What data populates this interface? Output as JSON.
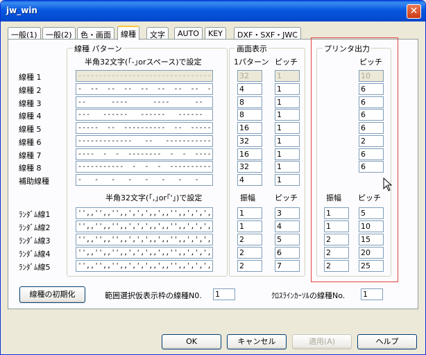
{
  "window": {
    "title": "jw_win",
    "close": "✕"
  },
  "tabs": [
    {
      "label": "一般(1)"
    },
    {
      "label": "一般(2)"
    },
    {
      "label": "色・画面"
    },
    {
      "label": "線種"
    },
    {
      "label": "文字"
    },
    {
      "label": "AUTO"
    },
    {
      "label": "KEY"
    },
    {
      "label": "DXF・SXF・JWC"
    }
  ],
  "pattern_group": {
    "label": "線種 パターン",
    "heading_top": "半角32文字(｢-｣orスペース)で設定",
    "heading_bottom": "半角32文字(｢,｣or｢'｣)で設定"
  },
  "display_group": {
    "label": "画面表示",
    "col1": "1パターン",
    "col2": "ピッチ",
    "col1_random": "振幅",
    "col2_random": "ピッチ"
  },
  "printer_group": {
    "label": "プリンタ出力",
    "col_pitch": "ピッチ",
    "col1_random": "振幅",
    "col2_random": "ピッチ"
  },
  "line_types": [
    {
      "label": "線種 1",
      "pattern": "--------------------------------",
      "pattern_disabled": true,
      "d1": "32",
      "d2": "1",
      "d_disabled": true,
      "p": "10",
      "p_disabled": true
    },
    {
      "label": "線種 2",
      "pattern": "-  --  --  --  --  --  --  --  --",
      "d1": "4",
      "d2": "1",
      "p": "6"
    },
    {
      "label": "線種 3",
      "pattern": "--      ----      ----      --",
      "d1": "8",
      "d2": "1",
      "p": "6"
    },
    {
      "label": "線種 4",
      "pattern": "---   ------   ------   ------   ---",
      "d1": "8",
      "d2": "1",
      "p": "6"
    },
    {
      "label": "線種 5",
      "pattern": "-----  --  ----------  --  -----",
      "d1": "16",
      "d2": "1",
      "p": "6"
    },
    {
      "label": "線種 6",
      "pattern": "-------------   --   ------------",
      "d1": "32",
      "d2": "1",
      "p": "2"
    },
    {
      "label": "線種 7",
      "pattern": "----  -  -  --------  -  -  ----",
      "d1": "16",
      "d2": "1",
      "p": "6"
    },
    {
      "label": "線種 8",
      "pattern": "-----------  -  -  -  -----------",
      "d1": "32",
      "d2": "1",
      "p": "6"
    },
    {
      "label": "補助線種",
      "pattern": "-   -   -   -   -   -   -   -   ",
      "d1": "4",
      "d2": "1"
    }
  ],
  "random_types": [
    {
      "label": "ﾗﾝﾀﾞﾑ線1",
      "pattern": "'',,'',,'',,',',',,',,'',,',',',",
      "d1": "1",
      "d2": "3",
      "p1": "1",
      "p2": "5"
    },
    {
      "label": "ﾗﾝﾀﾞﾑ線2",
      "pattern": "'',,'',,'',,',',',,',,'',,',',',",
      "d1": "1",
      "d2": "4",
      "p1": "1",
      "p2": "10"
    },
    {
      "label": "ﾗﾝﾀﾞﾑ線3",
      "pattern": "'',,'',,'',,',',',,',,'',,',',',",
      "d1": "2",
      "d2": "5",
      "p1": "2",
      "p2": "15"
    },
    {
      "label": "ﾗﾝﾀﾞﾑ線4",
      "pattern": "'',,'',,'',,',',',,',,'',,',',',",
      "d1": "2",
      "d2": "6",
      "p1": "2",
      "p2": "20"
    },
    {
      "label": "ﾗﾝﾀﾞﾑ線5",
      "pattern": "'',,'',,'',,',',',,',,'',,',',',",
      "d1": "2",
      "d2": "7",
      "p1": "2",
      "p2": "25"
    }
  ],
  "bottom": {
    "reset_button": "線種の初期化",
    "range_label": "範囲選択仮表示枠の線種N0.",
    "range_value": "1",
    "cross_label": "ｸﾛｽﾗｲﾝｶｰｿﾙの線種No.",
    "cross_value": "1"
  },
  "footer": {
    "ok": "OK",
    "cancel": "キャンセル",
    "apply": "適用(A)",
    "help": "ヘルプ"
  }
}
